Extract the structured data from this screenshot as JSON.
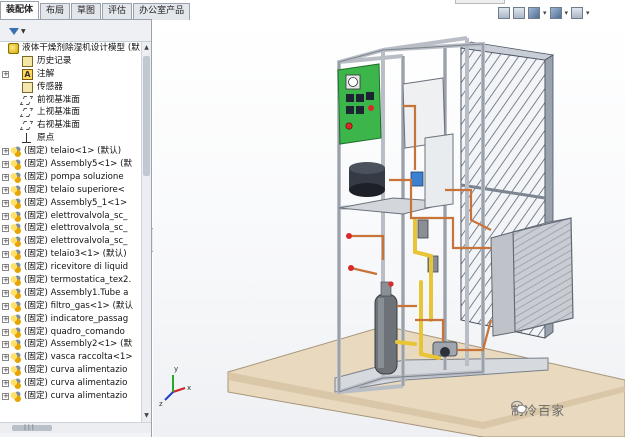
{
  "tabs": [
    {
      "label": "装配体",
      "active": true
    },
    {
      "label": "布局",
      "active": false
    },
    {
      "label": "草图",
      "active": false
    },
    {
      "label": "评估",
      "active": false
    },
    {
      "label": "办公室产品",
      "active": false
    }
  ],
  "tree": {
    "root": "液体干燥剂除湿机设计模型 (默",
    "items": [
      {
        "label": "历史记录",
        "icon": "history-icon"
      },
      {
        "label": "注解",
        "icon": "annotation-icon"
      },
      {
        "label": "传感器",
        "icon": "sensor-icon"
      },
      {
        "label": "前视基准面",
        "icon": "plane-icon"
      },
      {
        "label": "上视基准面",
        "icon": "plane-icon"
      },
      {
        "label": "右视基准面",
        "icon": "plane-icon"
      },
      {
        "label": "原点",
        "icon": "origin-icon"
      }
    ],
    "components": [
      "(固定) telaio<1> (默认)",
      "(固定) Assembly5<1> (默",
      "(固定) pompa soluzione",
      "(固定) telaio superiore<",
      "(固定) Assembly5_1<1>",
      "(固定) elettrovalvola_sc_",
      "(固定) elettrovalvola_sc_",
      "(固定) elettrovalvola_sc_",
      "(固定) telaio3<1> (默认)",
      "(固定) ricevitore di liquid",
      "(固定) termostatica_tex2.",
      "(固定) Assembly1.Tube a",
      "(固定) filtro_gas<1> (默认",
      "(固定) indicatore_passag",
      "(固定) quadro_comando",
      "(固定) Assembly2<1> (默",
      "(固定) vasca raccolta<1>",
      "(固定) curva alimentazio",
      "(固定) curva alimentazio",
      "(固定) curva alimentazio"
    ]
  },
  "triad": {
    "x": "x",
    "y": "y",
    "z": "z"
  },
  "watermark": "制冷百家",
  "colors": {
    "frame": "#b9bec6",
    "floor": "#e9d9bf",
    "panel_green": "#3cb64a",
    "copper": "#c8733a",
    "yellow_pipe": "#e8c437"
  }
}
